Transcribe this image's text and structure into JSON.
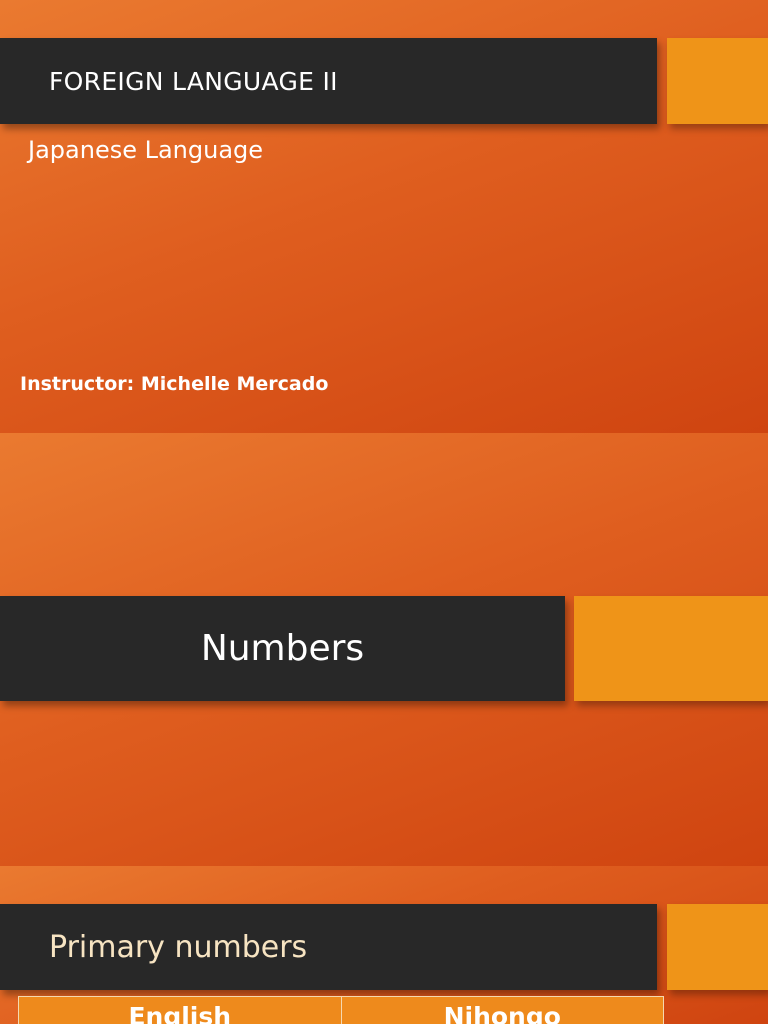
{
  "slides": [
    {
      "title": "FOREIGN LANGUAGE II",
      "subtitle": "Japanese Language",
      "instructor": "Instructor: Michelle Mercado"
    },
    {
      "title": "Numbers"
    },
    {
      "title": "Primary numbers",
      "table": {
        "headers": [
          "English",
          "Nihongo"
        ]
      }
    }
  ],
  "colors": {
    "title_bar": "#282828",
    "accent": "#ef9418",
    "background_gradient": [
      "#ea7a30",
      "#cf4410"
    ],
    "title_text_slide3": "#f7e4c2"
  }
}
